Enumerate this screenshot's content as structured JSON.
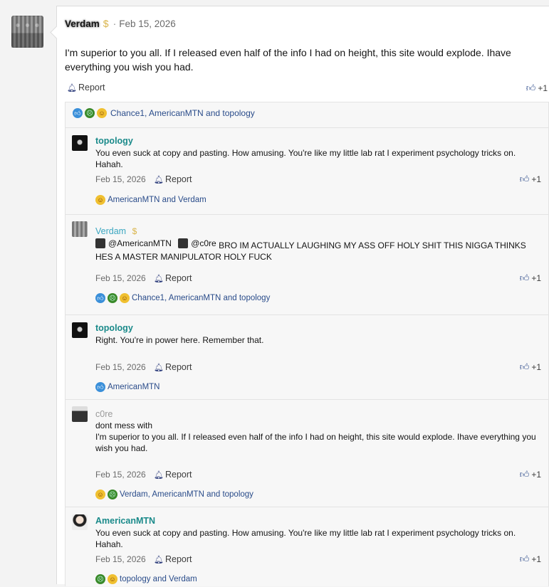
{
  "post": {
    "username": "Verdam",
    "badge_icon": "gold-coin-icon",
    "date": "Feb 15, 2026",
    "body": "I'm superior to you all. If I released even half of the info I had on height, this site would explode. Ihave everything you wish you had.",
    "report_label": "Report",
    "like_count": "+1",
    "reactions_text": "Chance1, AmericanMTN and topology"
  },
  "replies": [
    {
      "name": "topology",
      "text": "You even suck at copy and pasting. How amusing. You're like my little lab rat I experiment psychology tricks on. Hahah.",
      "date": "Feb 15, 2026",
      "report": "Report",
      "likes": "+1",
      "reactions": "AmericanMTN and Verdam"
    },
    {
      "name": "Verdam",
      "mention1": "@AmericanMTN",
      "mention2": "@c0re",
      "text": "BRO IM ACTUALLY LAUGHING MY ASS OFF HOLY SHIT THIS NIGGA THINKS HES A MASTER MANIPULATOR HOLY FUCK",
      "date": "Feb 15, 2026",
      "report": "Report",
      "likes": "+1",
      "reactions": "Chance1, AmericanMTN and topology"
    },
    {
      "name": "topology",
      "text": "Right. You're in power here. Remember that.",
      "date": "Feb 15, 2026",
      "report": "Report",
      "likes": "+1",
      "reactions": "AmericanMTN"
    },
    {
      "name": "c0re",
      "text_line1": "dont mess with",
      "text_line2": "I'm superior to you all. If I released even half of the info I had on height, this site would explode. Ihave everything you wish you had.",
      "date": "Feb 15, 2026",
      "report": "Report",
      "likes": "+1",
      "reactions": "Verdam, AmericanMTN and topology"
    },
    {
      "name": "AmericanMTN",
      "text": "You even suck at copy and pasting. How amusing. You're like my little lab rat I experiment psychology tricks on. Hahah.",
      "date": "Feb 15, 2026",
      "report": "Report",
      "likes": "+1",
      "reactions": "topology and Verdam"
    }
  ],
  "icons": {
    "like": "thumbs-up-icon",
    "report": "bell-icon",
    "reaction_like": "like-reaction-icon",
    "reaction_angry": "angry-reaction-icon",
    "reaction_laugh": "laugh-reaction-icon"
  },
  "colors": {
    "teal_name": "#1a8a8a",
    "link_blue": "#2a4c8a",
    "gold": "#d9b44a"
  }
}
